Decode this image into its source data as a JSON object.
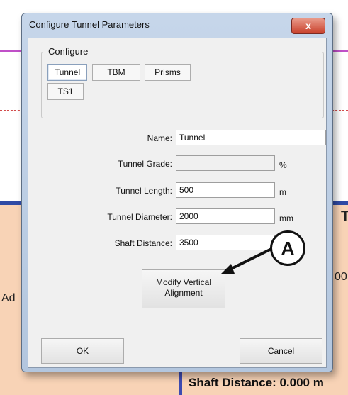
{
  "dialog": {
    "title": "Configure Tunnel Parameters",
    "close_label": "x"
  },
  "configure": {
    "legend": "Configure",
    "tabs": [
      "Tunnel",
      "TBM",
      "Prisms",
      "TS1"
    ],
    "active_tab": "Tunnel"
  },
  "fields": {
    "name": {
      "label": "Name:",
      "value": "Tunnel"
    },
    "grade": {
      "label": "Tunnel Grade:",
      "value": "",
      "unit": "%"
    },
    "length": {
      "label": "Tunnel Length:",
      "value": "500",
      "unit": "m"
    },
    "diameter": {
      "label": "Tunnel Diameter:",
      "value": "2000",
      "unit": "mm"
    },
    "shaft": {
      "label": "Shaft Distance:",
      "value": "3500"
    }
  },
  "buttons": {
    "modify_line1": "Modify Vertical",
    "modify_line2": "Alignment",
    "ok": "OK",
    "cancel": "Cancel"
  },
  "callout": "A",
  "background": {
    "left_text": "Ad",
    "right_text": "00",
    "right_top_text": "T",
    "bottom_text": "Shaft Distance:  0.000 m"
  }
}
